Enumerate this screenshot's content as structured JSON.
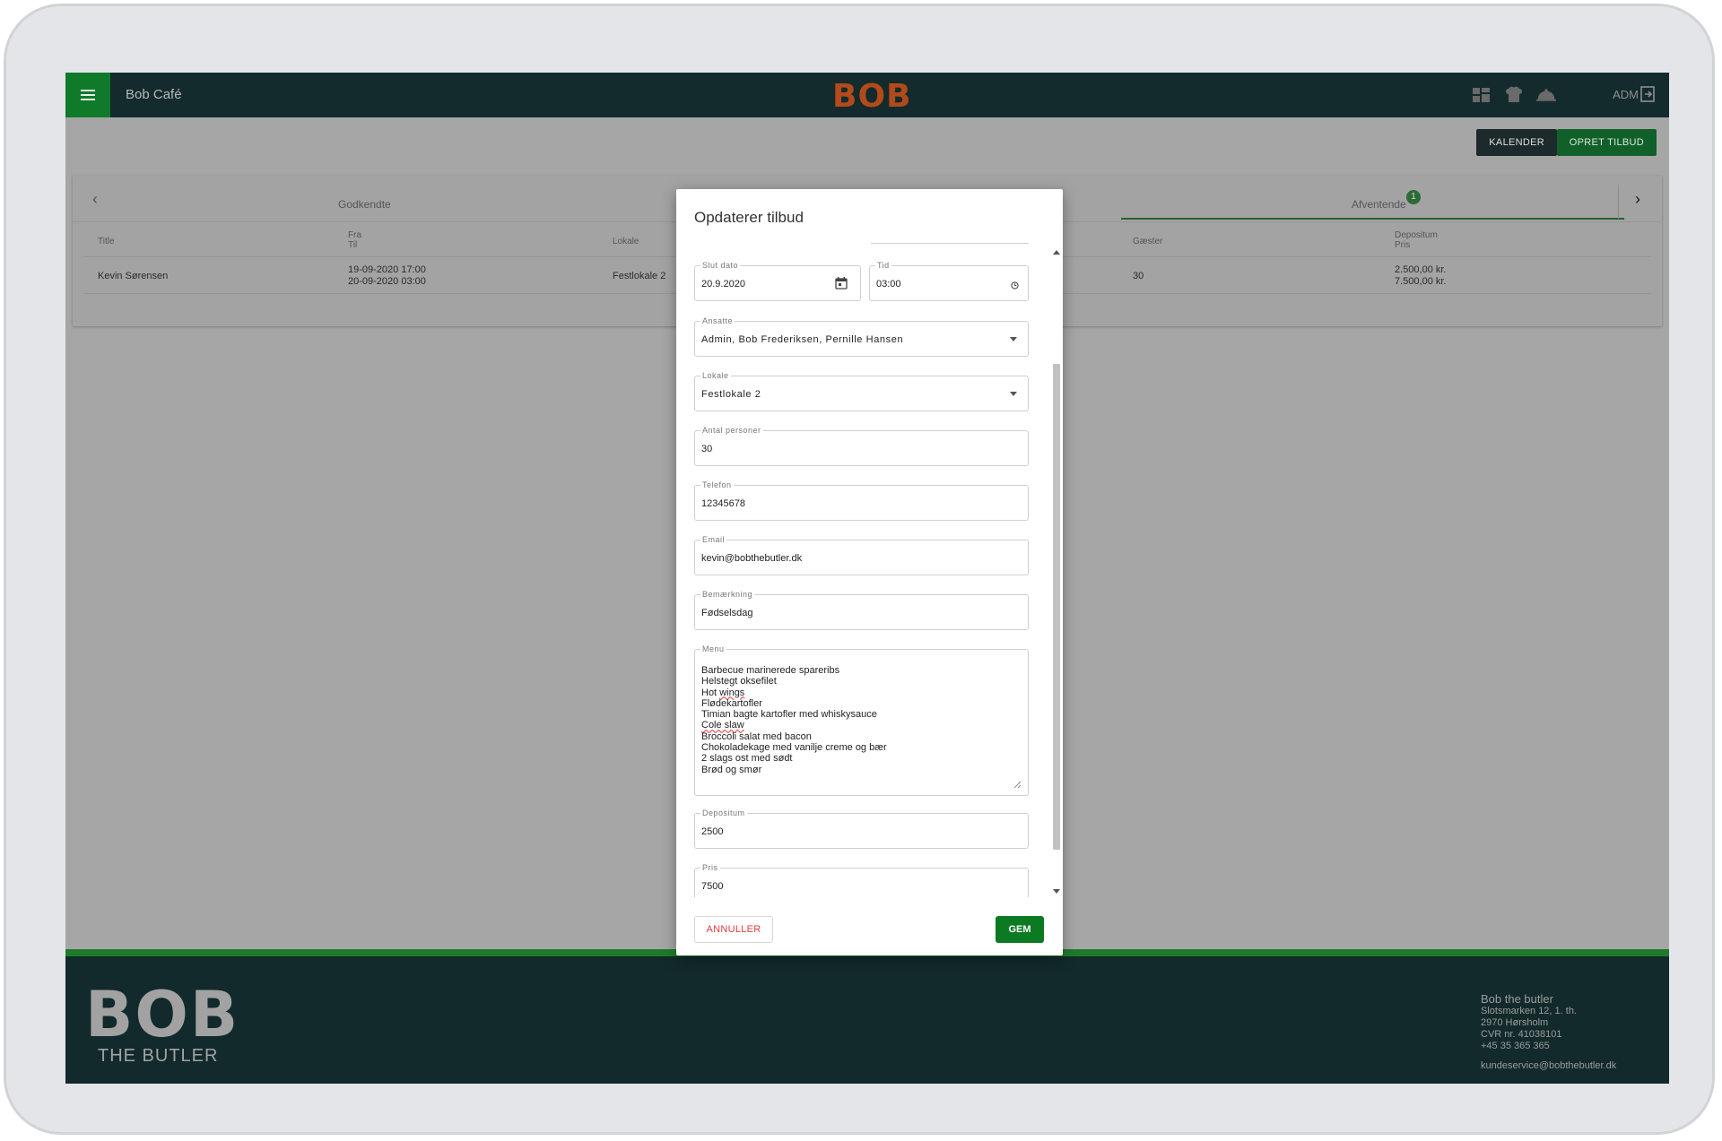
{
  "header": {
    "app_name": "Bob Café",
    "logo_text": "BOB",
    "user_label": "ADM",
    "icons": [
      "dashboard-icon",
      "chef-hat-icon",
      "cloche-icon",
      "logout-icon"
    ]
  },
  "toolbar": {
    "kalender_label": "KALENDER",
    "opret_label": "OPRET TILBUD"
  },
  "tabs": {
    "godkendte": "Godkendte",
    "afventende": "Afventende",
    "afventende_count": "1"
  },
  "table": {
    "columns": {
      "title": "Title",
      "fra": "Fra",
      "til": "Til",
      "lokale": "Lokale",
      "gaester": "Gæster",
      "depositum": "Depositum",
      "pris": "Pris"
    },
    "rows": [
      {
        "title": "Kevin Sørensen",
        "fra": "19-09-2020 17:00",
        "til": "20-09-2020 03:00",
        "lokale": "Festlokale 2",
        "gaester": "30",
        "depositum": "2.500,00 kr.",
        "pris": "7.500,00 kr."
      }
    ]
  },
  "modal": {
    "title": "Opdaterer tilbud",
    "fields": {
      "slut_dato": {
        "label": "Slut dato",
        "value": "20.9.2020"
      },
      "tid": {
        "label": "Tid",
        "value": "03:00"
      },
      "ansatte": {
        "label": "Ansatte",
        "value": "Admin, Bob Frederiksen, Pernille Hansen"
      },
      "lokale": {
        "label": "Lokale",
        "value": "Festlokale 2"
      },
      "antal_personer": {
        "label": "Antal personer",
        "value": "30"
      },
      "telefon": {
        "label": "Telefon",
        "value": "12345678"
      },
      "email": {
        "label": "Email",
        "value": "kevin@bobthebutler.dk"
      },
      "bemaerkning": {
        "label": "Bemærkning",
        "value": "Fødselsdag"
      },
      "menu": {
        "label": "Menu",
        "lines": [
          "Barbecue marinerede spareribs",
          "Helstegt oksefilet",
          "Hot wings",
          "Flødekartofler",
          "Timian bagte kartofler med whiskysauce",
          "Cole slaw",
          "Broccoli salat med bacon",
          "Chokoladekage med vanilje creme og bær",
          "2 slags ost med sødt",
          "Brød og smør"
        ]
      },
      "depositum": {
        "label": "Depositum",
        "value": "2500"
      },
      "pris": {
        "label": "Pris",
        "value": "7500"
      }
    },
    "cancel_label": "ANNULLER",
    "save_label": "GEM"
  },
  "footer": {
    "logo_main": "BOB",
    "logo_sub": "THE BUTLER",
    "company": "Bob the butler",
    "address1": "Slotsmarken 12, 1. th.",
    "address2": "2970 Hørsholm",
    "cvr": "CVR nr. 41038101",
    "phone": "+45 35 365 365",
    "email": "kundeservice@bobthebutler.dk"
  },
  "colors": {
    "header_bg": "#132b2c",
    "brand_green": "#0c7a22",
    "logo_orange": "#b24a1b",
    "cancel_red": "#e13b3b"
  }
}
